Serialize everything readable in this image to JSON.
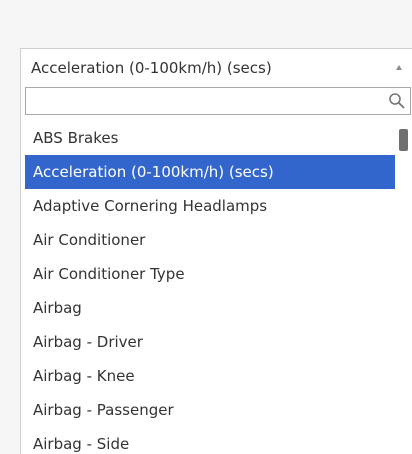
{
  "select": {
    "selected_value": "Acceleration (0-100km/h) (secs)",
    "arrow_icon": "caret-up-icon"
  },
  "search": {
    "value": "",
    "placeholder": "",
    "icon": "search-icon"
  },
  "options": [
    {
      "label": "ABS Brakes",
      "highlighted": false
    },
    {
      "label": "Acceleration (0-100km/h) (secs)",
      "highlighted": true
    },
    {
      "label": "Adaptive Cornering Headlamps",
      "highlighted": false
    },
    {
      "label": "Air Conditioner",
      "highlighted": false
    },
    {
      "label": "Air Conditioner Type",
      "highlighted": false
    },
    {
      "label": "Airbag",
      "highlighted": false
    },
    {
      "label": "Airbag - Driver",
      "highlighted": false
    },
    {
      "label": "Airbag - Knee",
      "highlighted": false
    },
    {
      "label": "Airbag - Passenger",
      "highlighted": false
    },
    {
      "label": "Airbag - Side",
      "highlighted": false
    }
  ],
  "colors": {
    "highlight": "#3366cc",
    "highlight_text": "#ffffff",
    "text": "#333333",
    "background": "#f5f5f5",
    "scrollbar_thumb": "#707070"
  }
}
